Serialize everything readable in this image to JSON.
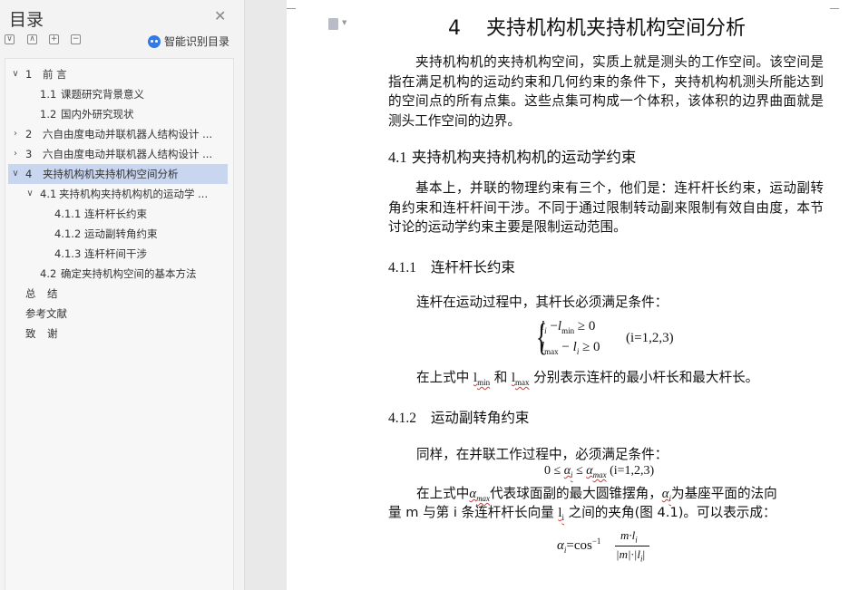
{
  "toc": {
    "title": "目录",
    "smart_label": "智能识别目录",
    "tool_buttons": [
      "∨",
      "∧",
      "+",
      "−"
    ],
    "items": [
      {
        "num": "1",
        "text": "前 言",
        "expand": "∨"
      },
      {
        "num": "1.1",
        "text": "课题研究背景意义",
        "expand": ""
      },
      {
        "num": "1.2",
        "text": "国内外研究现状",
        "expand": ""
      },
      {
        "num": "2",
        "text": "六自由度电动并联机器人结构设计 ...",
        "expand": "›"
      },
      {
        "num": "3",
        "text": "六自由度电动并联机器人结构设计 ...",
        "expand": "›"
      },
      {
        "num": "4",
        "text": "夹持机构机夹持机构空间分析",
        "expand": "∨"
      },
      {
        "num": "4.1",
        "text": "夹持机构夹持机构机的运动学 ...",
        "expand": "∨"
      },
      {
        "num": "4.1.1",
        "text": "连杆杆长约束",
        "expand": ""
      },
      {
        "num": "4.1.2",
        "text": "运动副转角约束",
        "expand": ""
      },
      {
        "num": "4.1.3",
        "text": "连杆杆间干涉",
        "expand": ""
      },
      {
        "num": "4.2",
        "text": "确定夹持机构空间的基本方法",
        "expand": ""
      },
      {
        "num": "总",
        "text": "结",
        "expand": ""
      },
      {
        "num": "",
        "text": "参考文献",
        "expand": ""
      },
      {
        "num": "致",
        "text": "谢",
        "expand": ""
      }
    ]
  },
  "doc": {
    "chapter_num": "4",
    "chapter_title": "夹持机构机夹持机构空间分析",
    "intro": "夹持机构机的夹持机构空间，实质上就是测头的工作空间。该空间是指在满足机构的运动约束和几何约束的条件下，夹持机构机测头所能达到的空间点的所有点集。这些点集可构成一个体积，该体积的边界曲面就是测头工作空间的边界。",
    "s41_num": "4.1",
    "s41_title": "夹持机构夹持机构机的运动学约束",
    "s41_text": "基本上，并联的物理约束有三个，他们是：连杆杆长约束，运动副转角约束和连杆杆间干涉。不同于通过限制转动副来限制有效自由度，本节讨论的运动学约束主要是限制运动范围。",
    "s411_num": "4.1.1",
    "s411_title": "连杆杆长约束",
    "s411_line1": "连杆在运动过程中，其杆长必须满足条件：",
    "eq1_row1": "l − l ≥ 0",
    "eq1_row2": "l − l ≥ 0",
    "eq1_l": "l",
    "eq1_i": "i",
    "eq1_min": "min",
    "eq1_max": "max",
    "eq1_minus": " −",
    "eq1_ge": " ≥ 0",
    "eq1_cond": "(i=1,2,3)",
    "s411_after_a": "在上式中 ",
    "s411_lmin": "l",
    "s411_lmin_sub": "min",
    "s411_and": " 和 ",
    "s411_lmax": "l",
    "s411_lmax_sub": "max",
    "s411_after_b": " 分别表示连杆的最小杆长和最大杆长。",
    "s412_num": "4.1.2",
    "s412_title": "运动副转角约束",
    "s412_line1": "同样，在并联工作过程中，必须满足条件：",
    "eq2_a": "0 ≤ ",
    "eq2_alpha": "α",
    "eq2_i": "i",
    "eq2_le": " ≤ ",
    "eq2_amax": "α",
    "eq2_max": "max",
    "eq2_cond": " (i=1,2,3)",
    "s412_p_a": "在上式中",
    "s412_amax": "α",
    "s412_amax_sub": "max",
    "s412_p_b": "代表球面副的最大圆锥摆角，",
    "s412_ai": "α",
    "s412_ai_sub": "i",
    "s412_p_c": "为基座平面的法向",
    "s412_p2_a": "量 m 与第 i 条连杆杆长向量 ",
    "s412_li": "l",
    "s412_li_sub": "i",
    "s412_p2_b": " 之间的夹角(图 4.1)。可以表示成：",
    "eq3_lhs": "α",
    "eq3_i": "i",
    "eq3_eq": "=cos",
    "eq3_sup": "−1",
    "eq3_num": "m·l",
    "eq3_num_i": "i",
    "eq3_den": "|m|·|l",
    "eq3_den_i": "i",
    "eq3_den_end": "|"
  }
}
